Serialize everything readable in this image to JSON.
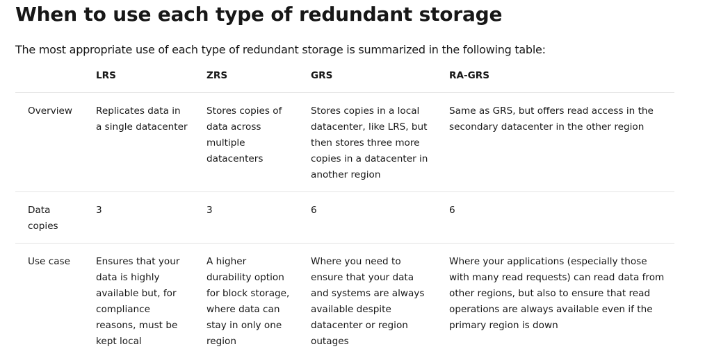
{
  "title": "When to use each type of redundant storage",
  "intro": "The most appropriate use of each type of redundant storage is summarized in the following table:",
  "table": {
    "headers": [
      "",
      "LRS",
      "ZRS",
      "GRS",
      "RA-GRS"
    ],
    "rows": [
      {
        "label": "Overview",
        "cells": [
          "Replicates data in a single datacenter",
          "Stores copies of data across multiple datacenters",
          "Stores copies in a local datacenter, like LRS, but then stores three more copies in a datacenter in another region",
          "Same as GRS, but offers read access in the secondary datacenter in the other region"
        ]
      },
      {
        "label": "Data copies",
        "cells": [
          "3",
          "3",
          "6",
          "6"
        ]
      },
      {
        "label": "Use case",
        "cells": [
          "Ensures that your data is highly available but, for compliance reasons, must be kept local",
          "A higher durability option for block storage, where data can stay in only one region",
          "Where you need to ensure that your data and systems are always available despite datacenter or region outages",
          "Where your applications (especially those with many read requests) can read data from other regions, but also to ensure that read operations are always available even if the primary region is down"
        ]
      }
    ]
  }
}
